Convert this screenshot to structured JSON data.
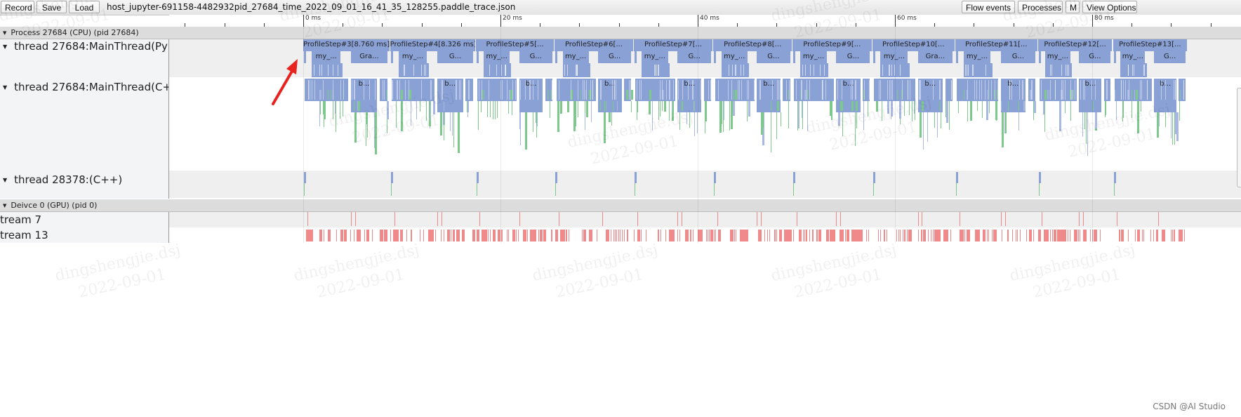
{
  "toolbar": {
    "record_label": "Record",
    "save_label": "Save",
    "load_label": "Load",
    "file_title": "host_jupyter-691158-4482932pid_27684_time_2022_09_01_16_41_35_128255.paddle_trace.json",
    "flow_events_label": "Flow events",
    "processes_label": "Processes",
    "m_label": "M",
    "view_options_label": "View Options"
  },
  "ruler": {
    "labels": [
      {
        "ms": 0,
        "text": "0 ms"
      },
      {
        "ms": 20,
        "text": "20 ms"
      },
      {
        "ms": 40,
        "text": "40 ms"
      },
      {
        "ms": 60,
        "text": "60 ms"
      },
      {
        "ms": 80,
        "text": "80 ms"
      }
    ],
    "minor_tick_ms": 4
  },
  "processes": [
    {
      "header": "Process 27684 (CPU) (pid 27684)",
      "threads": [
        {
          "name": "thread 27684:MainThread(Py"
        },
        {
          "name": "thread 27684:MainThread(C+"
        },
        {
          "name": "thread 28378:(C++)"
        }
      ]
    },
    {
      "header": "Deivce 0 (GPU) (pid 0)",
      "threads": [
        {
          "name": "tream 7"
        },
        {
          "name": "tream 13"
        }
      ]
    }
  ],
  "profile_steps": [
    {
      "label": "ProfileStep#3[8.760 ms]",
      "start_ms": 0,
      "sub1": "my_...",
      "sub2": "Gra..."
    },
    {
      "label": "ProfileStep#4[8.326 ms]",
      "start_ms": 8.8,
      "sub1": "my_...",
      "sub2": "G..."
    },
    {
      "label": "ProfileStep#5[...",
      "start_ms": 17.5,
      "sub1": "my_...",
      "sub2": "G..."
    },
    {
      "label": "ProfileStep#6[...",
      "start_ms": 25.5,
      "sub1": "my_...",
      "sub2": "G..."
    },
    {
      "label": "ProfileStep#7[...",
      "start_ms": 33.5,
      "sub1": "my_...",
      "sub2": "G..."
    },
    {
      "label": "ProfileStep#8[...",
      "start_ms": 41.6,
      "sub1": "my_...",
      "sub2": "G..."
    },
    {
      "label": "ProfileStep#9[...",
      "start_ms": 49.6,
      "sub1": "my_...",
      "sub2": "G..."
    },
    {
      "label": "ProfileStep#10[...",
      "start_ms": 57.7,
      "sub1": "my_...",
      "sub2": "Gra..."
    },
    {
      "label": "ProfileStep#11[...",
      "start_ms": 66.1,
      "sub1": "my_...",
      "sub2": "G..."
    },
    {
      "label": "ProfileStep#12[...",
      "start_ms": 74.5,
      "sub1": "my_...",
      "sub2": "G..."
    },
    {
      "label": "ProfileStep#13[...",
      "start_ms": 82.1,
      "sub1": "my_...",
      "sub2": "G..."
    }
  ],
  "trace_end_ms": 89.7,
  "cpp_block_label": "b...",
  "colors": {
    "slice_blue": "#8aa1d6",
    "slice_green": "#7cc98b",
    "gpu_red": "#f08a8a",
    "annotation_arrow": "#e8231f"
  },
  "watermark": {
    "line1": "dingshengjie.dsj",
    "line2": "2022-09-01"
  },
  "credit": "CSDN @AI Studio"
}
